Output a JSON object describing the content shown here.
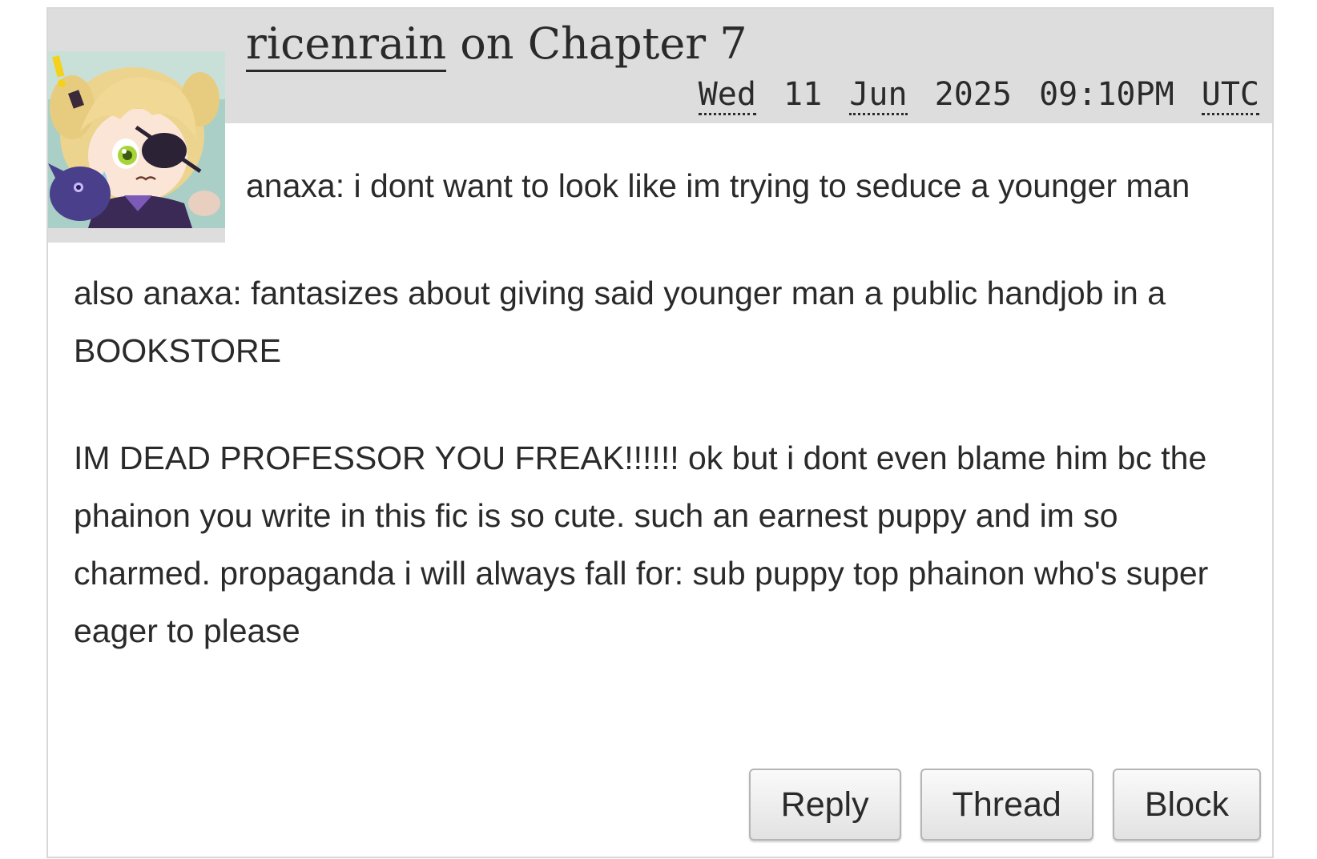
{
  "comment": {
    "author": "ricenrain",
    "on_text": "on",
    "chapter": "Chapter 7",
    "avatar_icon": "avatar-anime-girl-eyepatch",
    "date": {
      "weekday": "Wed",
      "day": "11",
      "month": "Jun",
      "year": "2025",
      "time": "09:10PM",
      "timezone": "UTC"
    },
    "paragraphs": [
      "anaxa: i dont want to look like im trying to seduce a younger man",
      "also anaxa: fantasizes about giving said younger man a public handjob in a BOOKSTORE",
      "IM DEAD PROFESSOR YOU FREAK!!!!!! ok but i dont even blame him bc the phainon you write in this fic is so cute. such an earnest puppy and im so charmed. propaganda i will always fall for: sub puppy top phainon who's super eager to please"
    ],
    "actions": {
      "reply": "Reply",
      "thread": "Thread",
      "block": "Block"
    }
  },
  "colors": {
    "header_bg": "#dddddd",
    "border": "#d8d8d8",
    "text": "#2a2a2a"
  }
}
